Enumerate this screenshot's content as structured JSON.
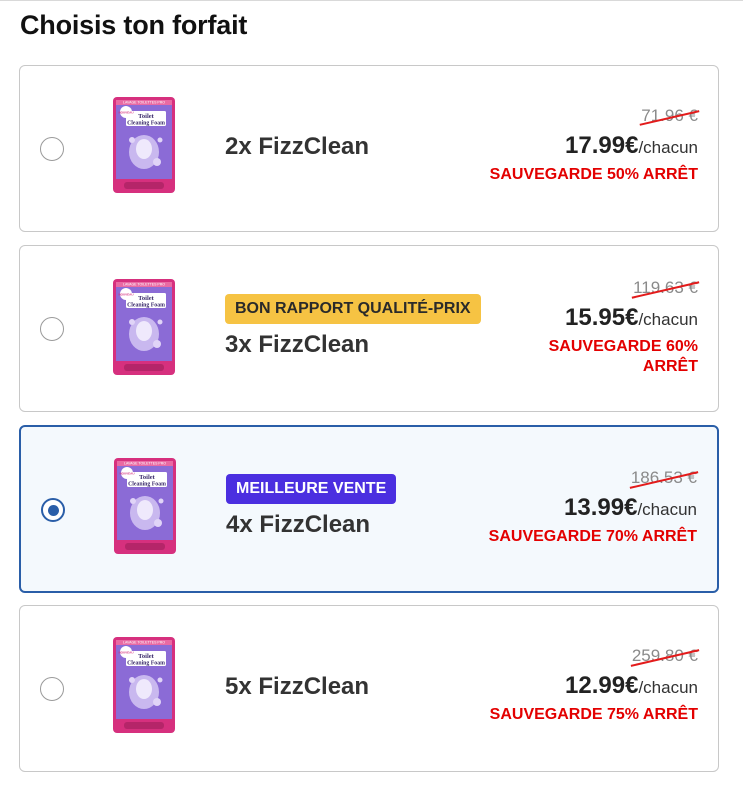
{
  "page": {
    "title": "Choisis ton forfait"
  },
  "product_image": {
    "header_text": "LAVAGE TOILETTES PRO",
    "corner_badge": "NOUVEAU",
    "label_line1": "Toilet",
    "label_line2": "Cleaning Foam",
    "colors": {
      "pink": "#d6307e",
      "purple": "#8b6bd6",
      "lavender": "#c9b8ef"
    }
  },
  "colors": {
    "accent": "#2a5ea8",
    "sale_red": "#e30000",
    "badge_yellow": "#f6c343",
    "badge_purple": "#4b2fe0"
  },
  "options": [
    {
      "name": "2x FizzClean",
      "old_price": "71.96 €",
      "price": "17.99€",
      "unit": "/chacun",
      "savings": "SAUVEGARDE 50% ARRÊT",
      "badge": "",
      "selected": false
    },
    {
      "name": "3x FizzClean",
      "old_price": "119.63 €",
      "price": "15.95€",
      "unit": "/chacun",
      "savings": "SAUVEGARDE 60% ARRÊT",
      "badge": "BON RAPPORT QUALITÉ-PRIX",
      "selected": false
    },
    {
      "name": "4x FizzClean",
      "old_price": "186.53 €",
      "price": "13.99€",
      "unit": "/chacun",
      "savings": "SAUVEGARDE 70% ARRÊT",
      "badge": "MEILLEURE VENTE",
      "selected": true
    },
    {
      "name": "5x FizzClean",
      "old_price": "259.80 €",
      "price": "12.99€",
      "unit": "/chacun",
      "savings": "SAUVEGARDE 75% ARRÊT",
      "badge": "",
      "selected": false
    }
  ]
}
